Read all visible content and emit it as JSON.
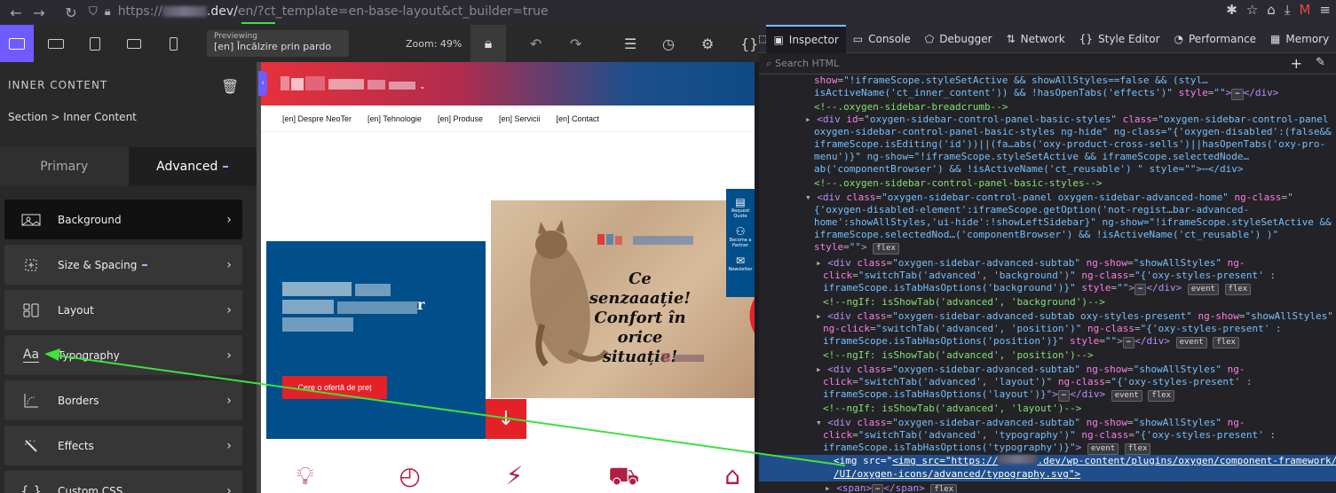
{
  "browser": {
    "url_prefix": "https://",
    "url_domain_suffix": ".dev/",
    "url_path_hl": "en/",
    "url_query": "?ct_template=en-base-layout&ct_builder=true"
  },
  "oxygen": {
    "previewing_label": "Previewing",
    "previewing_value": "[en] Încălzire prin pardo",
    "zoom_label": "Zoom: 49%"
  },
  "panel": {
    "title": "INNER CONTENT",
    "breadcrumb": "Section > Inner Content",
    "tab_primary": "Primary",
    "tab_advanced": "Advanced",
    "items": [
      {
        "label": "Background",
        "icon": "background-icon"
      },
      {
        "label": "Size & Spacing",
        "icon": "size-spacing-icon"
      },
      {
        "label": "Layout",
        "icon": "layout-icon"
      },
      {
        "label": "Typography",
        "icon": "typography-icon",
        "glyph": "Aa"
      },
      {
        "label": "Borders",
        "icon": "borders-icon"
      },
      {
        "label": "Effects",
        "icon": "effects-icon"
      },
      {
        "label": "Custom CSS",
        "icon": "custom-css-icon",
        "glyph": "{ }"
      }
    ]
  },
  "site": {
    "nav": [
      "[en] Despre NeoTer",
      "[en] Tehnologie",
      "[en] Produse",
      "[en] Servicii",
      "[en] Contact"
    ],
    "cta": "Cere o ofertă de preț",
    "hero_r": "r",
    "slogan": [
      "Ce senzaaație!",
      "Confort în",
      "orice situație!"
    ],
    "widget": [
      {
        "label": "Request Quote"
      },
      {
        "label": "Become a Partner"
      },
      {
        "label": "Newsletter"
      }
    ]
  },
  "devtools": {
    "tabs": [
      "Inspector",
      "Console",
      "Debugger",
      "Network",
      "Style Editor",
      "Performance",
      "Memory"
    ],
    "search_placeholder": "Search HTML",
    "lines": [
      "show=\"!iframeScope.styleSetActive && showAllStyles==false && (styl… isActiveName('ct_inner_content')) && !hasOpenTabs('effects')\" style=\"\">⋯</div>",
      "<!--.oxygen-sidebar-breadcrumb-->",
      "<div id=\"oxygen-sidebar-control-panel-basic-styles\" class=\"oxygen-sidebar-control-panel",
      "oxygen-sidebar-control-panel-basic-styles ng-hide\" ng-class=\"{'oxygen-disabled':(false&&",
      "iframeScope.isEditing('id'))||(fa…abs('oxy-product-cross-sells')||hasOpenTabs('oxy-pro-",
      "menu')}\" ng-show=\"!iframeScope.styleSetActive && iframeScope.selectedNode…",
      "ab('componentBrowser') && !isActiveName('ct_reusable') \" style=\"\">⋯</div>",
      "<!--.oxygen-sidebar-control-panel-basic-styles-->",
      "<div class=\"oxygen-sidebar-control-panel oxygen-sidebar-advanced-home\" ng-class=\"",
      "{'oxygen-disabled-element':iframeScope.getOption('not-regist…bar-advanced-",
      "home':showAllStyles,'ui-hide':!showLeftSidebar}\" ng-show=\"!iframeScope.styleSetActive &&",
      "iframeScope.selectedNod…('componentBrowser') && !isActiveName('ct_reusable') )\"",
      "style=\"\">",
      "<div class=\"oxygen-sidebar-advanced-subtab\" ng-show=\"showAllStyles\" ng-",
      "click=\"switchTab('advanced', 'background')\" ng-class=\"{'oxy-styles-present' :",
      "iframeScope.isTabHasOptions('background')}\" style=\"\">⋯</div>",
      "<!--ngIf: isShowTab('advanced', 'background')-->",
      "<div class=\"oxygen-sidebar-advanced-subtab oxy-styles-present\" ng-show=\"showAllStyles\"",
      "ng-click=\"switchTab('advanced', 'position')\" ng-class=\"{'oxy-styles-present' :",
      "iframeScope.isTabHasOptions('position')}\" style=\"\">⋯</div>",
      "<!--ngIf: isShowTab('advanced', 'position')-->",
      "<div class=\"oxygen-sidebar-advanced-subtab\" ng-show=\"showAllStyles\" ng-",
      "click=\"switchTab('advanced', 'layout')\" ng-class=\"{'oxy-styles-present' :",
      "iframeScope.isTabHasOptions('layout')}\">⋯</div>",
      "<!--ngIf: isShowTab('advanced', 'layout')-->",
      "<div class=\"oxygen-sidebar-advanced-subtab\" ng-show=\"showAllStyles\" ng-",
      "click=\"switchTab('advanced', 'typography')\" ng-class=\"{'oxy-styles-present' :",
      "iframeScope.isTabHasOptions('typography')}\">",
      "<img src=\"https://",
      ".dev/wp-content/plugins/oxygen/component-framework/toolbar",
      "/UI/oxygen-icons/advanced/typography.svg\">",
      "<span>⋯</span>"
    ],
    "badge_flex": "flex",
    "badge_event": "event"
  },
  "colors": {
    "accent": "#6f5bff",
    "brand_red": "#e42127",
    "brand_blue": "#004e8a",
    "annotation": "#3fe13f"
  }
}
